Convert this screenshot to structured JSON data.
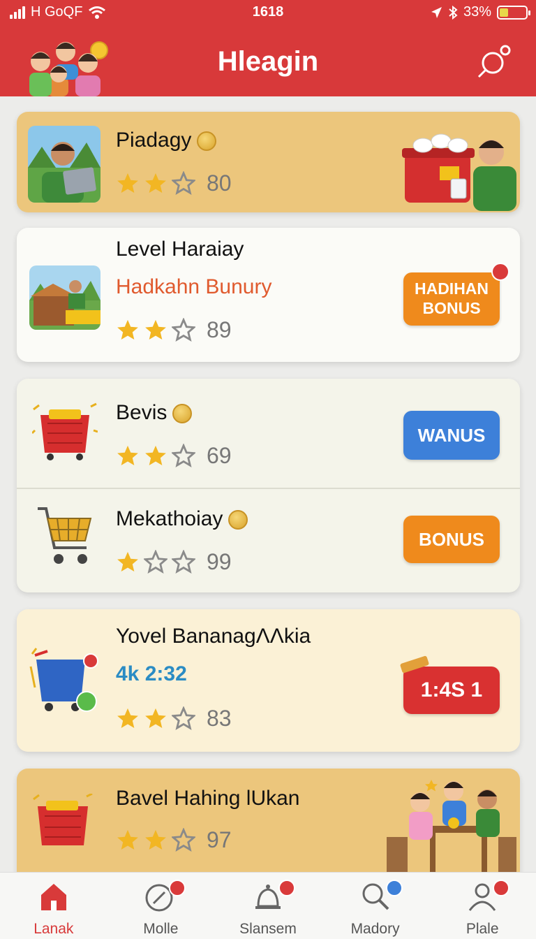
{
  "status_bar": {
    "carrier": "H GoQF",
    "time": "1618",
    "battery": "33%",
    "battery_level": 0.33
  },
  "header": {
    "title": "Hleagin"
  },
  "cards": [
    {
      "title": "Piadagy",
      "rating": "80",
      "stars": 2
    },
    {
      "title": "Level Haraiay",
      "subtitle": "Hadkahn Bunury",
      "rating": "89",
      "stars": 2,
      "button_line1": "HADIHAN",
      "button_line2": "BONUS"
    },
    {
      "title": "Bevis",
      "rating": "69",
      "stars": 2,
      "button": "WANUS"
    },
    {
      "title": "Mekathoiay",
      "rating": "99",
      "stars": 1,
      "button": "BONUS"
    },
    {
      "title": "Yovel BananagΛΛkia",
      "subtitle": "4k 2:32",
      "rating": "83",
      "stars": 2,
      "button": "1:4S 1"
    },
    {
      "title": "Bavel Hahing lUkan",
      "rating": "97",
      "stars": 2
    }
  ],
  "nav": [
    {
      "label": "Lanak",
      "icon": "home-icon",
      "active": true
    },
    {
      "label": "Molle",
      "icon": "compass-icon"
    },
    {
      "label": "Slansem",
      "icon": "bell-icon"
    },
    {
      "label": "Madory",
      "icon": "search-icon"
    },
    {
      "label": "Plale",
      "icon": "profile-icon"
    }
  ],
  "colors": {
    "brand_red": "#d8393a",
    "orange": "#ef8a1c",
    "blue": "#3d80d9",
    "star": "#f2b623"
  }
}
